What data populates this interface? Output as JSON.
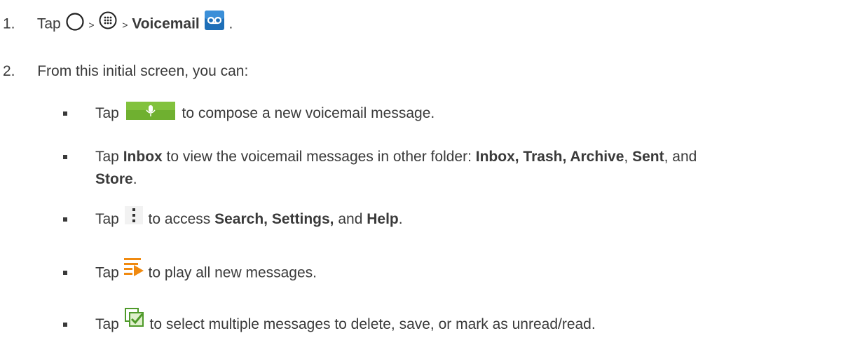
{
  "steps": [
    {
      "number": "1.",
      "tap": "Tap",
      "sep1": ">",
      "sep2": ">",
      "voicemail": "Voicemail",
      "end": ".",
      "icons": [
        "home-circle-icon",
        "apps-grid-icon",
        "voicemail-app-icon"
      ]
    },
    {
      "number": "2.",
      "text": "From this initial screen, you can:"
    }
  ],
  "bullets": [
    {
      "tap": "Tap",
      "icon": "compose-mic-button",
      "text": "to compose a new voicemail message."
    },
    {
      "tap": "Tap",
      "bold1": "Inbox",
      "t1": "to view the voicemail messages in other folder:",
      "bold2": "Inbox, Trash, Archive",
      "t2": ",",
      "bold3": "Sent",
      "t3": ", and",
      "bold4": "Store",
      "t4": "."
    },
    {
      "tap": "Tap",
      "icon": "menu-dots-icon",
      "t1": "to access",
      "bold1": "Search, Settings,",
      "t2": "and",
      "bold2": "Help",
      "t3": "."
    },
    {
      "tap": "Tap",
      "icon": "play-all-icon",
      "text": "to play all new messages."
    },
    {
      "tap": "Tap",
      "icon": "select-multiple-icon",
      "text": "to select multiple messages to delete, save, or mark as unread/read."
    }
  ]
}
